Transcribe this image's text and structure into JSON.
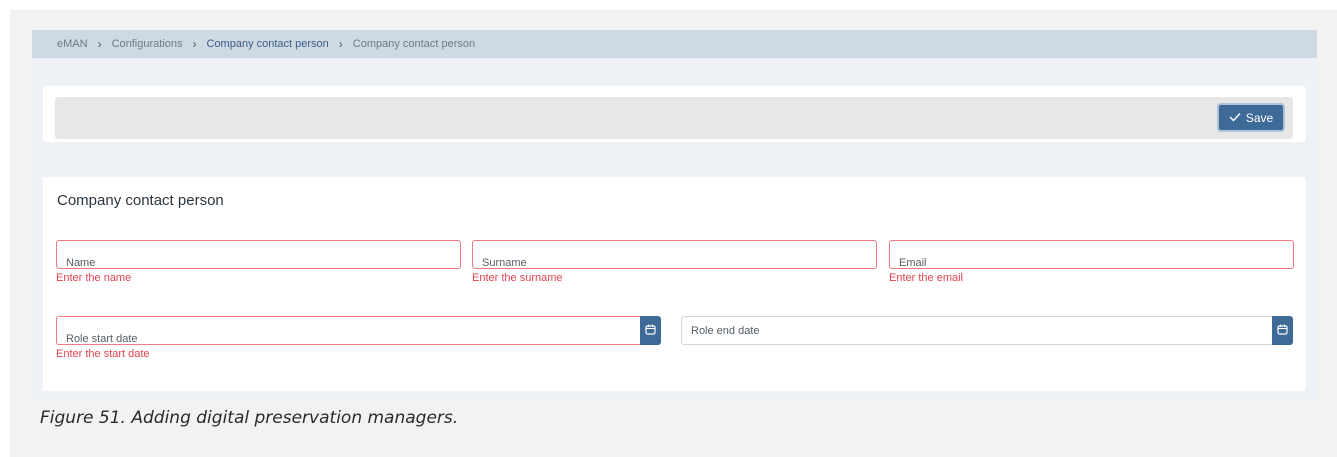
{
  "breadcrumb": {
    "items": [
      "eMAN",
      "Configurations",
      "Company contact person",
      "Company contact person"
    ],
    "separator": "›"
  },
  "toolbar": {
    "save_label": "Save"
  },
  "form": {
    "title": "Company contact person",
    "fields": {
      "name": {
        "label": "Name",
        "error": "Enter the name"
      },
      "surname": {
        "label": "Surname",
        "error": "Enter the surname"
      },
      "email": {
        "label": "Email",
        "error": "Enter the email"
      },
      "role_start": {
        "label": "Role start date",
        "error": "Enter the start date"
      },
      "role_end": {
        "label": "Role end date"
      }
    }
  },
  "caption": "Figure 51. Adding digital preservation managers.",
  "colors": {
    "accent": "#3d6a97",
    "error": "#e0444f",
    "breadcrumb_bg": "#cfd9e3"
  },
  "icons": {
    "save": "check-icon",
    "calendar": "calendar-icon"
  }
}
